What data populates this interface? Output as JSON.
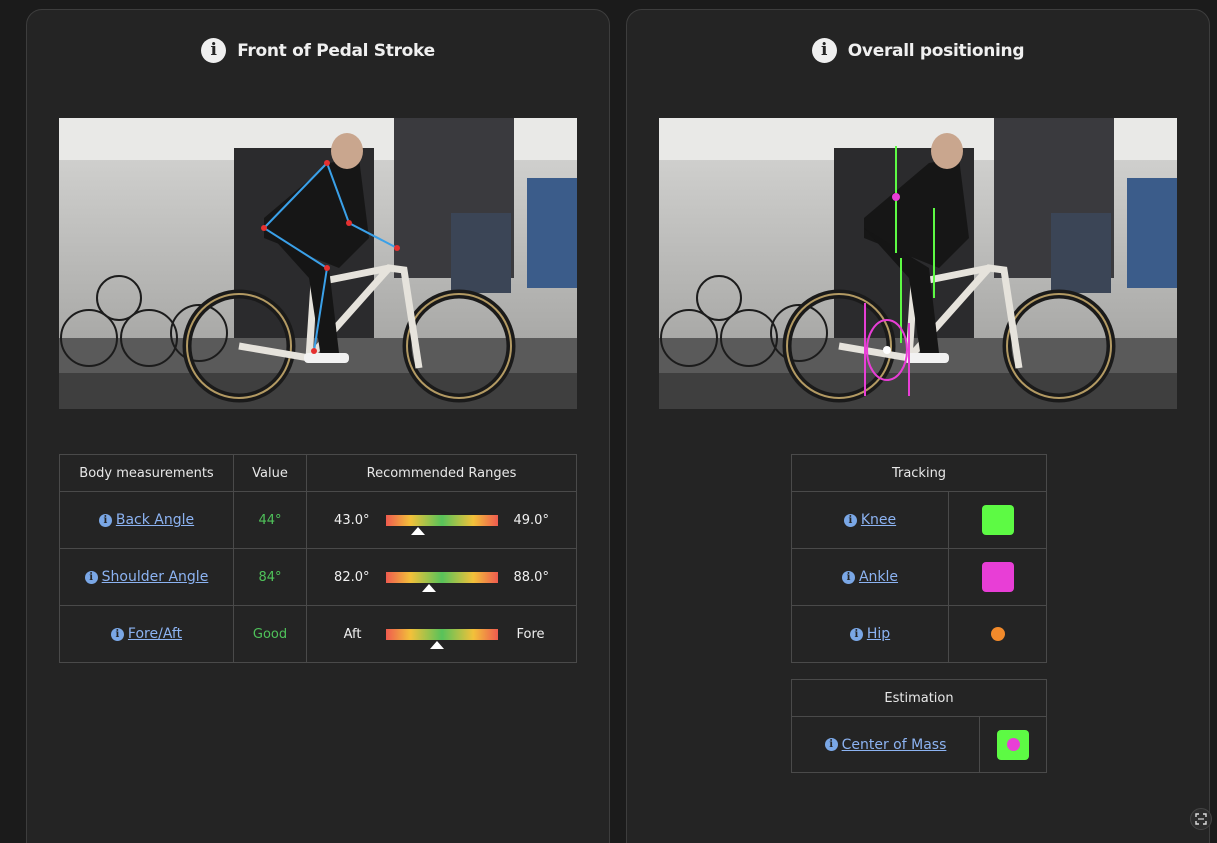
{
  "colors": {
    "knee": "#5dfa44",
    "ankle": "#e83ed6",
    "hip": "#f28a2b",
    "good": "#4fc25a",
    "link": "#8cb3f2",
    "skeleton": "#3aa0e8",
    "joint": "#e53030"
  },
  "left_panel": {
    "title": "Front of Pedal Stroke",
    "icon": "info-icon",
    "table": {
      "headers": [
        "Body measurements",
        "Value",
        "Recommended Ranges"
      ],
      "rows": [
        {
          "label": "Back Angle",
          "value": "44°",
          "min": "43.0°",
          "max": "49.0°",
          "position": 0.29
        },
        {
          "label": "Shoulder Angle",
          "value": "84°",
          "min": "82.0°",
          "max": "88.0°",
          "position": 0.39
        },
        {
          "label": "Fore/Aft",
          "value": "Good",
          "min": "Aft",
          "max": "Fore",
          "position": 0.46
        }
      ]
    }
  },
  "right_panel": {
    "title": "Overall positioning",
    "icon": "info-icon",
    "tracking": {
      "header": "Tracking",
      "rows": [
        {
          "label": "Knee"
        },
        {
          "label": "Ankle"
        },
        {
          "label": "Hip"
        }
      ]
    },
    "estimation": {
      "header": "Estimation",
      "rows": [
        {
          "label": "Center of Mass"
        }
      ]
    }
  }
}
